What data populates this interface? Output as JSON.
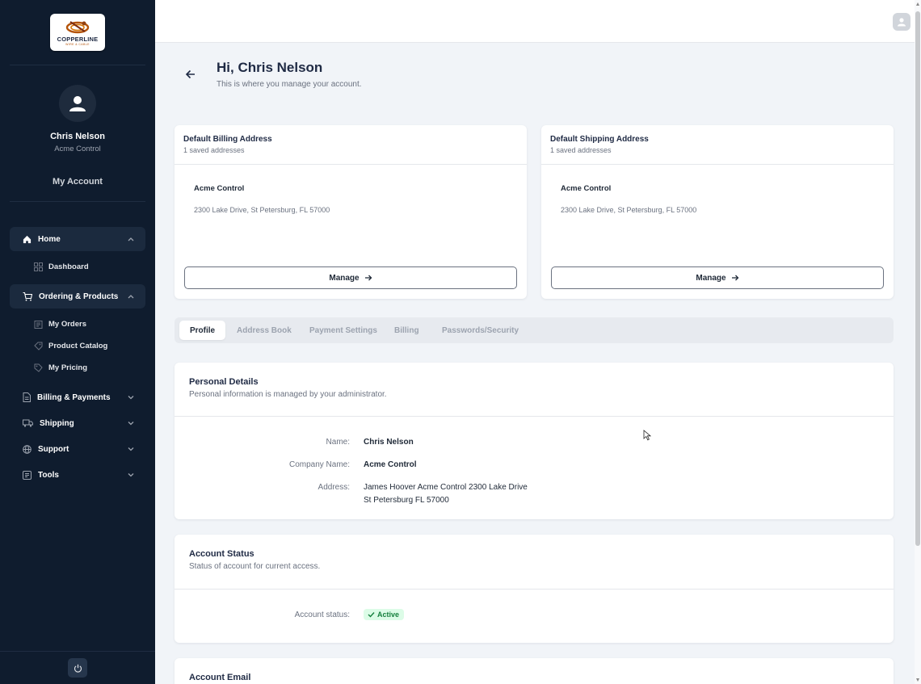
{
  "sidebar": {
    "logo": {
      "brand": "COPPERLINE",
      "sub": "WIRE & CABLE"
    },
    "user": {
      "name": "Chris Nelson",
      "company": "Acme Control"
    },
    "my_account": "My Account",
    "nav": {
      "home": {
        "label": "Home",
        "icon": "home-icon",
        "expanded": true
      },
      "dashboard": {
        "label": "Dashboard",
        "icon": "grid-icon"
      },
      "ordering": {
        "label": "Ordering & Products",
        "icon": "cart-icon",
        "expanded": true
      },
      "my_orders": {
        "label": "My Orders",
        "icon": "orders-icon"
      },
      "product_catalog": {
        "label": "Product Catalog",
        "icon": "tag-icon"
      },
      "my_pricing": {
        "label": "My Pricing",
        "icon": "price-tag-icon"
      },
      "billing": {
        "label": "Billing & Payments",
        "icon": "document-icon",
        "expanded": false
      },
      "shipping": {
        "label": "Shipping",
        "icon": "truck-icon",
        "expanded": false
      },
      "support": {
        "label": "Support",
        "icon": "globe-icon",
        "expanded": false
      },
      "tools": {
        "label": "Tools",
        "icon": "tools-icon",
        "expanded": false
      }
    }
  },
  "header": {
    "greeting": "Hi, Chris Nelson",
    "subtitle": "This is where you manage your account."
  },
  "billing_card": {
    "title": "Default Billing Address",
    "count": "1 saved addresses",
    "company": "Acme Control",
    "address": "2300 Lake Drive, St Petersburg, FL 57000",
    "manage_label": "Manage"
  },
  "shipping_card": {
    "title": "Default Shipping Address",
    "count": "1 saved addresses",
    "company": "Acme Control",
    "address": "2300 Lake Drive, St Petersburg, FL 57000",
    "manage_label": "Manage"
  },
  "tabs": {
    "profile": "Profile",
    "address_book": "Address Book",
    "payment_settings": "Payment Settings",
    "billing": "Billing",
    "passwords": "Passwords/Security",
    "active": "Profile"
  },
  "personal_details": {
    "title": "Personal Details",
    "subtitle": "Personal information is managed by your administrator.",
    "name_label": "Name:",
    "name_value": "Chris Nelson",
    "company_label": "Company Name:",
    "company_value": "Acme Control",
    "address_label": "Address:",
    "address_line1": "James Hoover Acme Control 2300 Lake Drive",
    "address_line2": "St Petersburg FL 57000"
  },
  "account_status": {
    "title": "Account Status",
    "subtitle": "Status of account for current access.",
    "status_label": "Account status:",
    "status_value": "Active"
  },
  "account_email": {
    "title": "Account Email"
  },
  "colors": {
    "sidebar_bg": "#0f1c2e",
    "accent": "#1f2a44",
    "success": "#15803d"
  }
}
